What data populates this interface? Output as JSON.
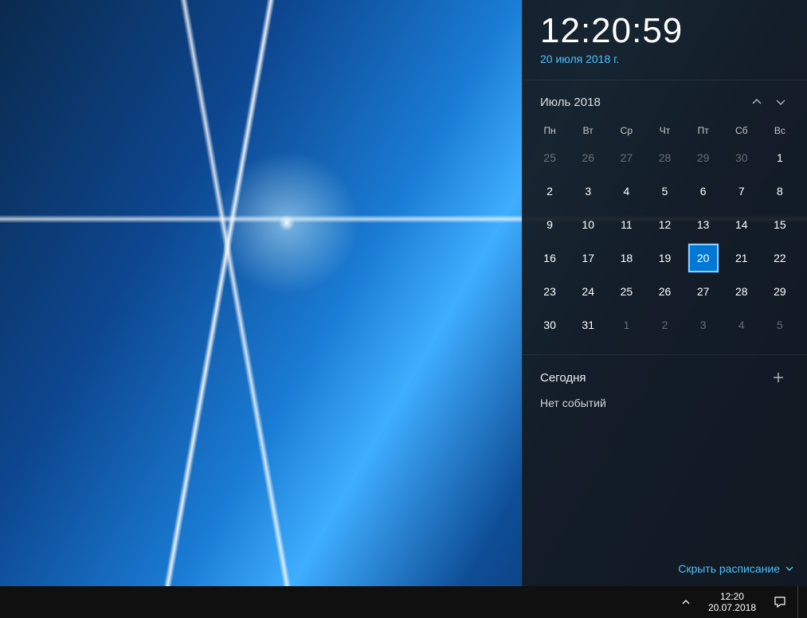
{
  "clock": {
    "time": "12:20:59",
    "date_link": "20 июля 2018 г."
  },
  "calendar": {
    "month_label": "Июль 2018",
    "day_headers": [
      "Пн",
      "Вт",
      "Ср",
      "Чт",
      "Пт",
      "Сб",
      "Вс"
    ],
    "weeks": [
      [
        {
          "d": "25",
          "other": true
        },
        {
          "d": "26",
          "other": true
        },
        {
          "d": "27",
          "other": true
        },
        {
          "d": "28",
          "other": true
        },
        {
          "d": "29",
          "other": true
        },
        {
          "d": "30",
          "other": true
        },
        {
          "d": "1"
        }
      ],
      [
        {
          "d": "2"
        },
        {
          "d": "3"
        },
        {
          "d": "4"
        },
        {
          "d": "5"
        },
        {
          "d": "6"
        },
        {
          "d": "7"
        },
        {
          "d": "8"
        }
      ],
      [
        {
          "d": "9"
        },
        {
          "d": "10"
        },
        {
          "d": "11"
        },
        {
          "d": "12"
        },
        {
          "d": "13"
        },
        {
          "d": "14"
        },
        {
          "d": "15"
        }
      ],
      [
        {
          "d": "16"
        },
        {
          "d": "17"
        },
        {
          "d": "18"
        },
        {
          "d": "19"
        },
        {
          "d": "20",
          "today": true
        },
        {
          "d": "21"
        },
        {
          "d": "22"
        }
      ],
      [
        {
          "d": "23"
        },
        {
          "d": "24"
        },
        {
          "d": "25"
        },
        {
          "d": "26"
        },
        {
          "d": "27"
        },
        {
          "d": "28"
        },
        {
          "d": "29"
        }
      ],
      [
        {
          "d": "30"
        },
        {
          "d": "31"
        },
        {
          "d": "1",
          "other": true
        },
        {
          "d": "2",
          "other": true
        },
        {
          "d": "3",
          "other": true
        },
        {
          "d": "4",
          "other": true
        },
        {
          "d": "5",
          "other": true
        }
      ]
    ]
  },
  "agenda": {
    "title": "Сегодня",
    "no_events": "Нет событий",
    "hide_label": "Скрыть расписание"
  },
  "taskbar": {
    "clock_time": "12:20",
    "clock_date": "20.07.2018"
  }
}
